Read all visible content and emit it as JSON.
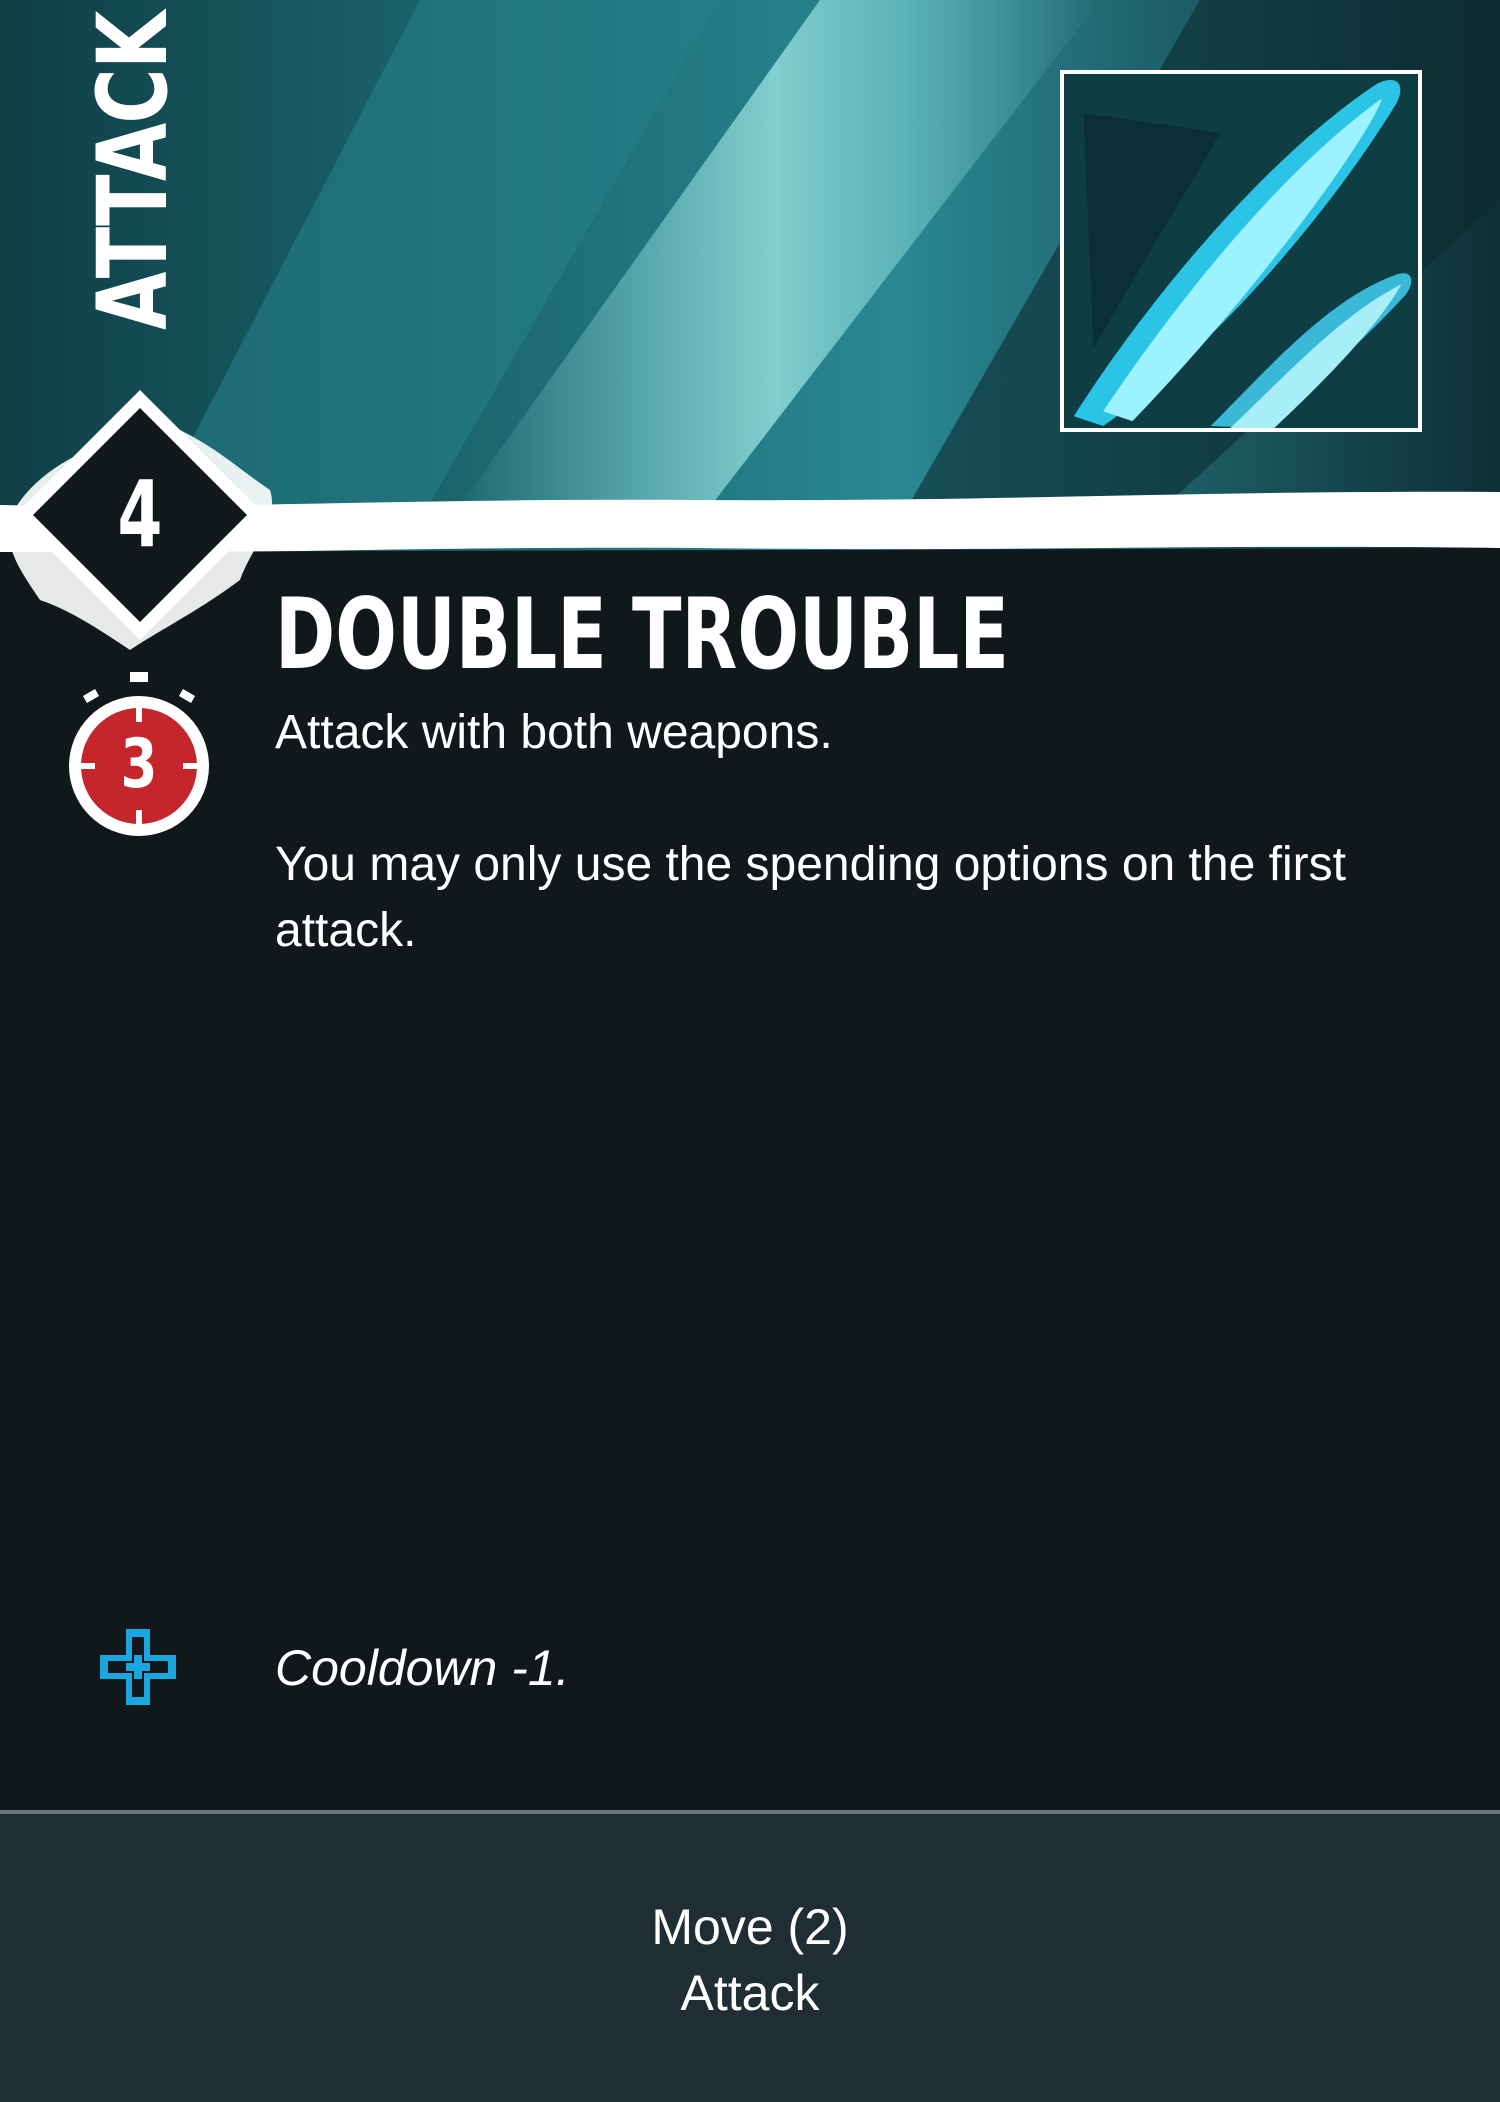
{
  "card": {
    "category": "ATTACK",
    "cost": "4",
    "cooldown": "3",
    "title": "DOUBLE TROUBLE",
    "description": [
      "Attack with both weapons.",
      "You may only use the spending options on the first attack."
    ],
    "bonus": {
      "icon": "plus-cross-icon",
      "text": "Cooldown -1."
    },
    "footer": {
      "line1": "Move (2)",
      "line2": "Attack"
    }
  },
  "colors": {
    "background": "#11181b",
    "footer_bg": "#202d35",
    "accent_cyan": "#1aa7e0",
    "timer_red": "#c4262b",
    "banner_teal": "#1f6f78"
  }
}
